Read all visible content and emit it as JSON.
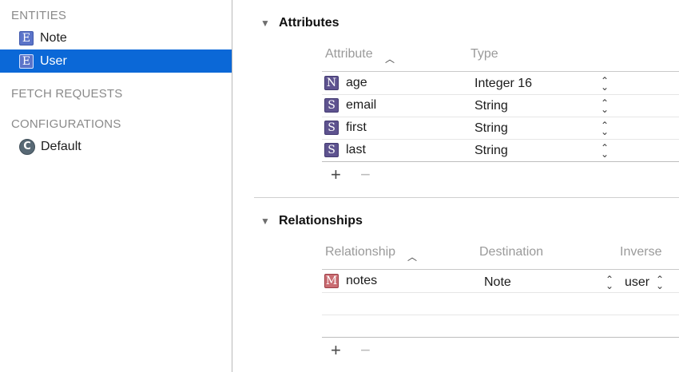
{
  "sidebar": {
    "entities_heading": "ENTITIES",
    "entities": [
      {
        "badge": "E",
        "label": "Note",
        "selected": false
      },
      {
        "badge": "E",
        "label": "User",
        "selected": true
      }
    ],
    "fetch_heading": "FETCH REQUESTS",
    "config_heading": "CONFIGURATIONS",
    "configurations": [
      {
        "badge": "C",
        "label": "Default"
      }
    ]
  },
  "attributes": {
    "title": "Attributes",
    "col_attribute": "Attribute",
    "col_type": "Type",
    "rows": [
      {
        "badge": "N",
        "name": "age",
        "type": "Integer 16"
      },
      {
        "badge": "S",
        "name": "email",
        "type": "String"
      },
      {
        "badge": "S",
        "name": "first",
        "type": "String"
      },
      {
        "badge": "S",
        "name": "last",
        "type": "String"
      }
    ],
    "add": "+",
    "remove": "−"
  },
  "relationships": {
    "title": "Relationships",
    "col_relationship": "Relationship",
    "col_destination": "Destination",
    "col_inverse": "Inverse",
    "rows": [
      {
        "badge": "M",
        "name": "notes",
        "destination": "Note",
        "inverse": "user"
      }
    ],
    "add": "+",
    "remove": "−"
  },
  "colors": {
    "selection": "#0b68d7",
    "entity_badge": "#5b74c9",
    "attribute_badge": "#5e538f",
    "relationship_badge": "#c96c72"
  }
}
